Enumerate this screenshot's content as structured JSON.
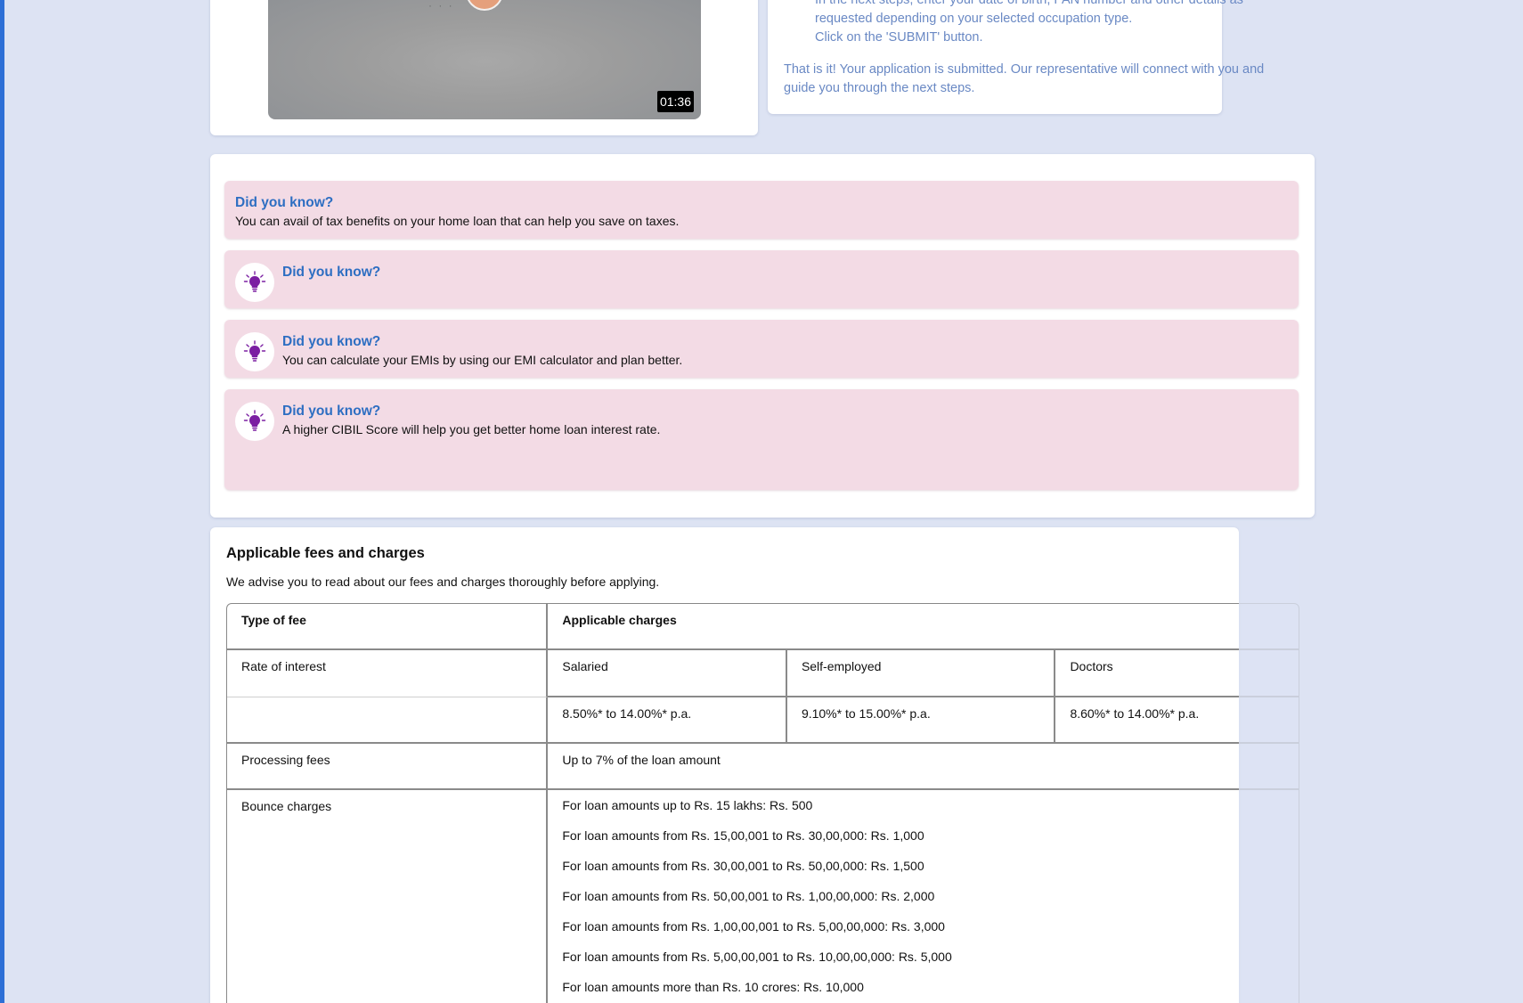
{
  "video": {
    "duration": "01:36"
  },
  "steps": {
    "items": [
      "In the next steps, enter your date of birth, PAN number and other details as",
      "requested depending on your selected occupation type.",
      "Click on the 'SUBMIT' button."
    ],
    "final": [
      "That is it! Your application is submitted. Our representative will connect with you and",
      "guide you through the next steps."
    ]
  },
  "tips": [
    {
      "title": "Did you know?",
      "text": "You can avail of tax benefits on your home loan that can help you save on taxes.",
      "icon": "bulb-icon"
    },
    {
      "title": "Did you know?",
      "text": "",
      "icon": "bulb-icon"
    },
    {
      "title": "Did you know?",
      "text": "You can calculate your EMIs by using our EMI calculator and plan better.",
      "icon": "bulb-icon"
    },
    {
      "title": "Did you know?",
      "text": "A higher CIBIL Score will help you get better home loan interest rate.",
      "icon": "bulb-icon"
    }
  ],
  "fees": {
    "title": "Applicable fees and charges",
    "subtitle": "We advise you to read about our fees and charges thoroughly before applying.",
    "header": {
      "type": "Type of fee",
      "charges": "Applicable charges"
    },
    "rate": {
      "label": "Rate of interest",
      "cols": [
        "Salaried",
        "Self-employed",
        "Doctors"
      ],
      "values": [
        "8.50%* to 14.00%* p.a.",
        "9.10%* to 15.00%* p.a.",
        "8.60%* to 14.00%* p.a."
      ]
    },
    "processing": {
      "label": "Processing fees",
      "value": "Up to 7% of the loan amount"
    },
    "bounce": {
      "label": "Bounce charges",
      "items": [
        "For loan amounts up to Rs. 15 lakhs: Rs. 500",
        "For loan amounts from Rs. 15,00,001 to Rs. 30,00,000: Rs. 1,000",
        "For loan amounts from Rs. 30,00,001 to Rs. 50,00,000: Rs. 1,500",
        "For loan amounts from Rs. 50,00,001 to Rs. 1,00,00,000: Rs. 2,000",
        "For loan amounts from Rs. 1,00,00,001 to Rs. 5,00,00,000: Rs. 3,000",
        "For loan amounts from Rs. 5,00,00,001 to Rs. 10,00,00,000: Rs. 5,000",
        "For loan amounts more than Rs. 10 crores: Rs. 10,000"
      ]
    }
  },
  "colors": {
    "page_bg": "#dde3f3",
    "accent": "#2d6ec2",
    "tip_bg": "#f3dbe5",
    "steps_text": "#6a89c4"
  }
}
